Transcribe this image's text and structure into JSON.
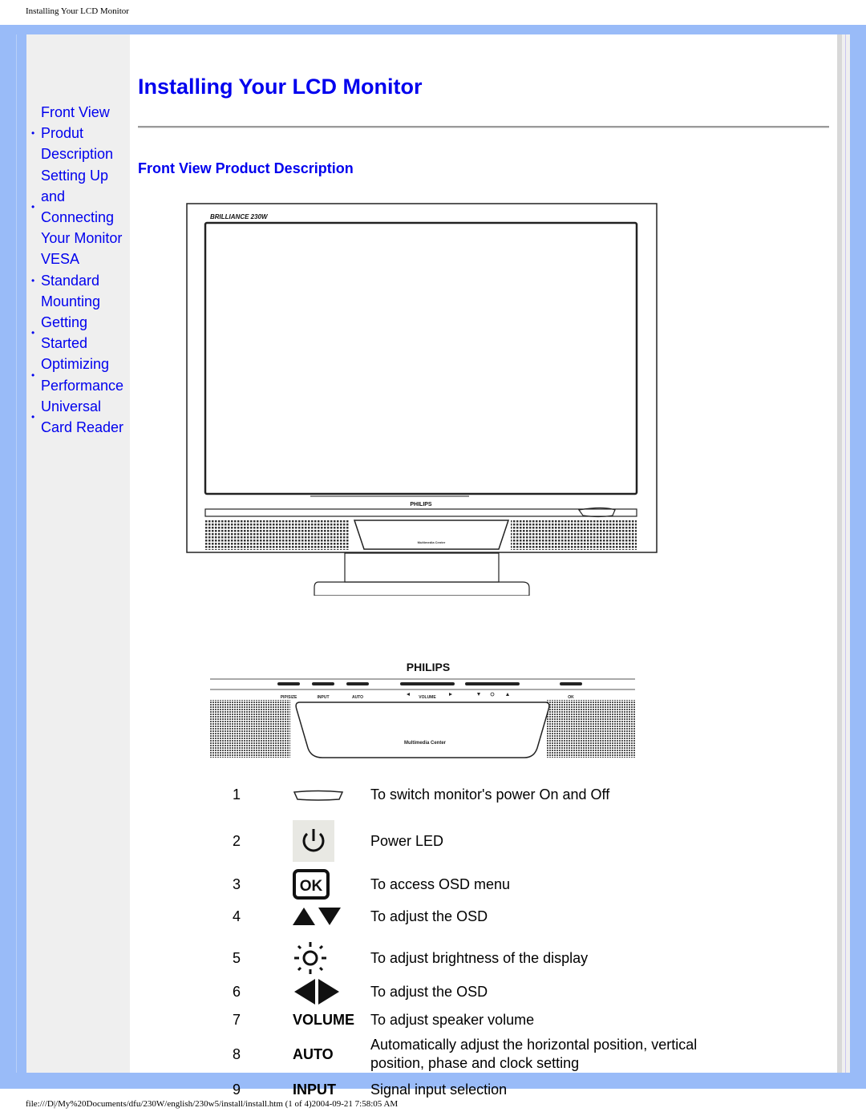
{
  "print_header": "Installing Your LCD Monitor",
  "print_footer": "file:///D|/My%20Documents/dfu/230W/english/230w5/install/install.htm (1 of 4)2004-09-21 7:58:05 AM",
  "colors": {
    "frame": "#99bbf8",
    "sidebar_bg": "#efefef",
    "link": "#0000ee"
  },
  "sidebar": {
    "items": [
      {
        "lines": [
          "Front View",
          "Produt",
          "Description"
        ],
        "bullet": true
      },
      {
        "lines": [
          "Setting Up",
          "and",
          "Connecting",
          "Your Monitor"
        ],
        "bullet": true
      },
      {
        "lines": [
          "VESA",
          "Standard",
          "Mounting"
        ],
        "bullet": true
      },
      {
        "lines": [
          "Getting",
          "Started"
        ],
        "bullet": true
      },
      {
        "lines": [
          "Optimizing",
          "Performance"
        ],
        "bullet": true
      },
      {
        "lines": [
          "Universal",
          "Card Reader"
        ],
        "bullet": true
      }
    ]
  },
  "main": {
    "title": "Installing Your LCD Monitor",
    "section_title": "Front View Product Description",
    "monitor_drawing": {
      "brand": "PHILIPS",
      "model_logo": "BRILLIANCE 230W",
      "card_reader_label": "Multimedia Center"
    },
    "panel_drawing": {
      "brand": "PHILIPS",
      "button_labels": [
        "PIP/SIZE",
        "INPUT",
        "AUTO",
        "VOLUME",
        "OK"
      ],
      "center_label": "Multimedia Center"
    },
    "legend": [
      {
        "num": "1",
        "icon": "power-button-shape-icon",
        "desc": "To switch monitor's power On and Off"
      },
      {
        "num": "2",
        "icon": "power-led-icon",
        "desc": "Power LED"
      },
      {
        "num": "3",
        "icon": "ok-button-icon",
        "icon_text": "OK",
        "desc": "To access OSD menu"
      },
      {
        "num": "4",
        "icon": "up-down-arrows-icon",
        "desc": "To adjust the OSD"
      },
      {
        "num": "5",
        "icon": "brightness-sun-icon",
        "desc": "To adjust brightness of the display"
      },
      {
        "num": "6",
        "icon": "left-right-arrows-icon",
        "desc": "To adjust the OSD"
      },
      {
        "num": "7",
        "keyword": "VOLUME",
        "desc": "To adjust speaker volume"
      },
      {
        "num": "8",
        "keyword": "AUTO",
        "desc": "Automatically adjust the horizontal position, vertical position, phase and clock setting"
      },
      {
        "num": "9",
        "keyword": "INPUT",
        "desc": "Signal input selection"
      }
    ]
  }
}
